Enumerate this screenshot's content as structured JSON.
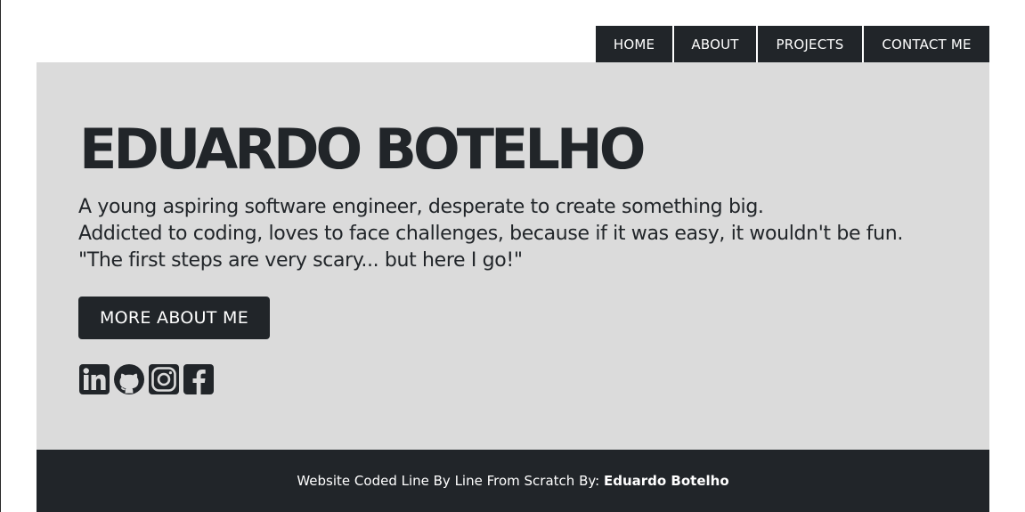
{
  "nav": {
    "items": [
      {
        "label": "HOME"
      },
      {
        "label": "ABOUT"
      },
      {
        "label": "PROJECTS"
      },
      {
        "label": "CONTACT ME"
      }
    ]
  },
  "hero": {
    "title": "EDUARDO BOTELHO",
    "lines": [
      "A young aspiring software engineer, desperate to create something big.",
      "Addicted to coding, loves to face challenges, because if it was easy, it wouldn't be fun.",
      "\"The first steps are very scary... but here I go!\""
    ],
    "button_label": "MORE ABOUT ME",
    "socials": [
      "linkedin-icon",
      "github-icon",
      "instagram-icon",
      "facebook-icon"
    ]
  },
  "footer": {
    "text": "Website Coded Line By Line From Scratch By: ",
    "author": "Eduardo Botelho"
  },
  "colors": {
    "dark": "#212529",
    "hero_bg": "#dbdbdb",
    "light": "#ffffff"
  }
}
